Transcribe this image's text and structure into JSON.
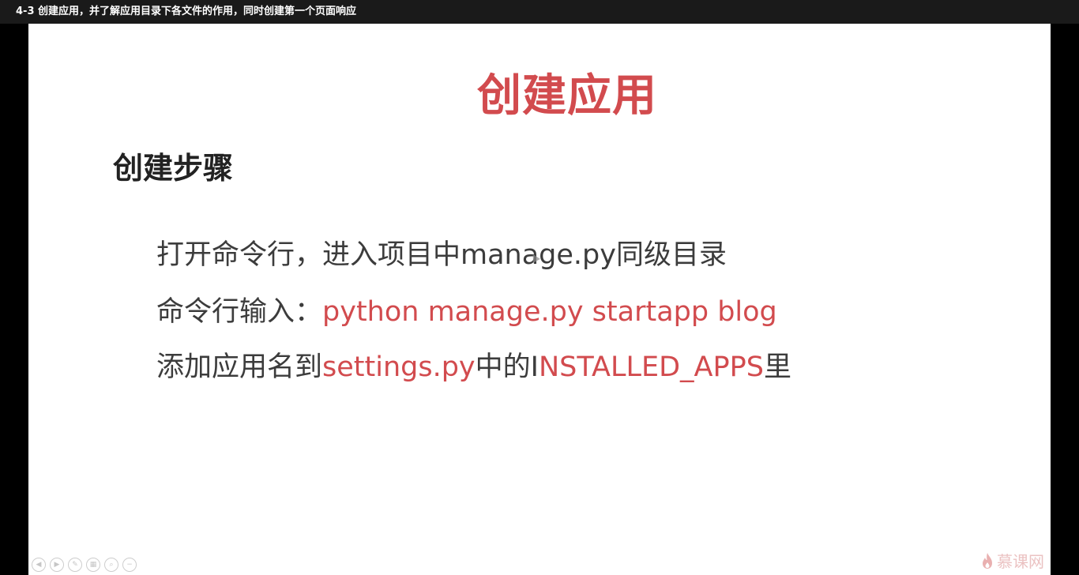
{
  "window": {
    "title": "4-3 创建应用，并了解应用目录下各文件的作用，同时创建第一个页面响应"
  },
  "slide": {
    "title": "创建应用",
    "section_heading": "创建步骤",
    "steps": [
      {
        "parts": [
          {
            "text": "打开命令行，进入项目中manage.py同级目录",
            "red": false
          }
        ]
      },
      {
        "parts": [
          {
            "text": "命令行输入：",
            "red": false
          },
          {
            "text": "python manage.py startapp blog",
            "red": true
          }
        ]
      },
      {
        "parts": [
          {
            "text": "添加应用名到",
            "red": false
          },
          {
            "text": "settings.py",
            "red": true
          },
          {
            "text": "中的I",
            "red": false
          },
          {
            "text": "NSTALLED_APPS",
            "red": true
          },
          {
            "text": "里",
            "red": false
          }
        ]
      }
    ],
    "watermark": "慕课网"
  },
  "controls": [
    {
      "icon": "previous-icon",
      "glyph": "◀"
    },
    {
      "icon": "next-icon",
      "glyph": "▶"
    },
    {
      "icon": "pen-icon",
      "glyph": "✎"
    },
    {
      "icon": "slides-icon",
      "glyph": "▦"
    },
    {
      "icon": "zoom-icon",
      "glyph": "⌕"
    },
    {
      "icon": "more-icon",
      "glyph": "−"
    }
  ],
  "colors": {
    "accent_red": "#d24b4e",
    "body_text": "#3c3c3c",
    "heading_text": "#222222"
  }
}
